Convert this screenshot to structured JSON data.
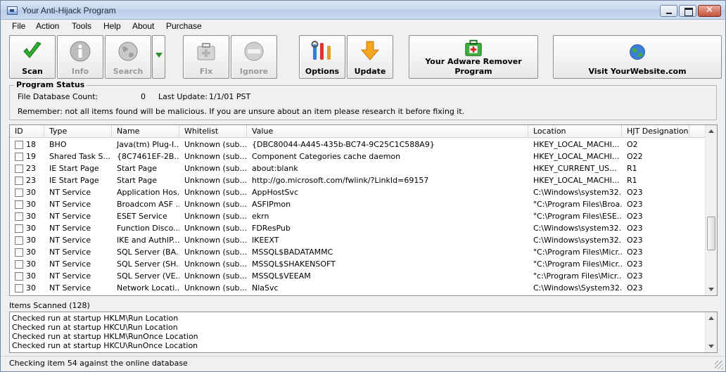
{
  "window": {
    "title": "Your Anti-Hijack Program"
  },
  "menu": [
    "File",
    "Action",
    "Tools",
    "Help",
    "About",
    "Purchase"
  ],
  "toolbar": {
    "scan": "Scan",
    "info": "Info",
    "search": "Search",
    "fix": "Fix",
    "ignore": "Ignore",
    "options": "Options",
    "update": "Update",
    "adware_line1": "Your Adware Remover",
    "adware_line2": "Program",
    "website": "Visit YourWebsite.com"
  },
  "status": {
    "legend": "Program Status",
    "db_count_label": "File Database Count:",
    "db_count_value": "0",
    "last_update_label": "Last Update:",
    "last_update_value": "1/1/01 PST",
    "remember": "Remember: not all items found will be malicious.  If you are unsure about an item please research it before fixing it."
  },
  "grid": {
    "columns": [
      "ID",
      "Type",
      "Name",
      "Whitelist",
      "Value",
      "Location",
      "HJT Designation"
    ],
    "rows": [
      [
        "18",
        "BHO",
        "Java(tm) Plug-I...",
        "Unknown (sub...",
        "{DBC80044-A445-435b-BC74-9C25C1C588A9}",
        "HKEY_LOCAL_MACHI...",
        "O2"
      ],
      [
        "19",
        "Shared Task S...",
        "{8C7461EF-2B...",
        "Unknown (sub...",
        "Component Categories cache daemon",
        "HKEY_LOCAL_MACHI...",
        "O22"
      ],
      [
        "23",
        "IE Start Page",
        "Start Page",
        "Unknown (sub...",
        "about:blank",
        "HKEY_CURRENT_US...",
        "R1"
      ],
      [
        "23",
        "IE Start Page",
        "Start Page",
        "Unknown (sub...",
        "http://go.microsoft.com/fwlink/?LinkId=69157",
        "HKEY_LOCAL_MACHI...",
        "R1"
      ],
      [
        "30",
        "NT Service",
        "Application Hos...",
        "Unknown (sub...",
        "AppHostSvc",
        "C:\\Windows\\system32...",
        "O23"
      ],
      [
        "30",
        "NT Service",
        "Broadcom ASF ...",
        "Unknown (sub...",
        "ASFIPmon",
        "\"C:\\Program Files\\Broa...",
        "O23"
      ],
      [
        "30",
        "NT Service",
        "ESET Service",
        "Unknown (sub...",
        "ekrn",
        "\"C:\\Program Files\\ESE...",
        "O23"
      ],
      [
        "30",
        "NT Service",
        "Function Disco...",
        "Unknown (sub...",
        "FDResPub",
        "C:\\Windows\\system32...",
        "O23"
      ],
      [
        "30",
        "NT Service",
        "IKE and AuthIP...",
        "Unknown (sub...",
        "IKEEXT",
        "C:\\Windows\\system32...",
        "O23"
      ],
      [
        "30",
        "NT Service",
        "SQL Server (BA...",
        "Unknown (sub...",
        "MSSQL$BADATAMMC",
        "\"C:\\Program Files\\Micr...",
        "O23"
      ],
      [
        "30",
        "NT Service",
        "SQL Server (SH...",
        "Unknown (sub...",
        "MSSQL$SHAKENSOFT",
        "\"C:\\Program Files\\Micr...",
        "O23"
      ],
      [
        "30",
        "NT Service",
        "SQL Server (VE...",
        "Unknown (sub...",
        "MSSQL$VEEAM",
        "\"c:\\Program Files\\Micr...",
        "O23"
      ],
      [
        "30",
        "NT Service",
        "Network Locati...",
        "Unknown (sub...",
        "NlaSvc",
        "C:\\Windows\\System32...",
        "O23"
      ]
    ]
  },
  "items_scanned": "Items Scanned (128)",
  "log": [
    "Checked run at startup HKLM\\Run Location",
    "Checked run at startup HKCU\\Run Location",
    "Checked run at startup HKLM\\RunOnce Location",
    "Checked run at startup HKCU\\RunOnce Location"
  ],
  "statusbar": "Checking item 54 against the online database"
}
